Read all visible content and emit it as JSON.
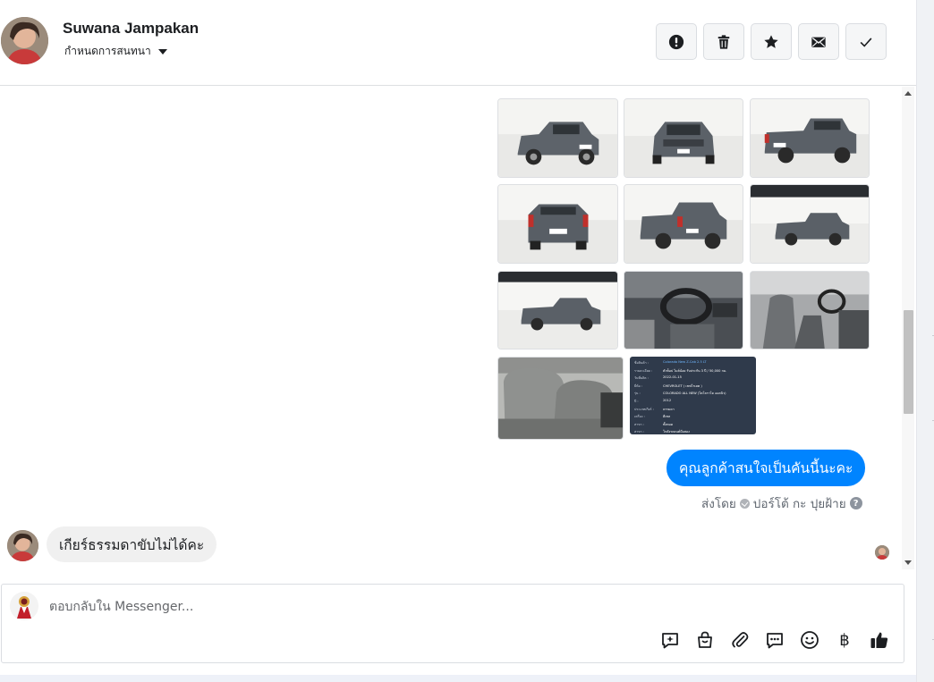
{
  "header": {
    "contact_name": "Suwana Jampakan",
    "assign_label": "กำหนดการสนทนา",
    "actions": [
      {
        "name": "mark-spam-button",
        "icon": "alert-icon"
      },
      {
        "name": "delete-button",
        "icon": "trash-icon"
      },
      {
        "name": "star-button",
        "icon": "star-icon"
      },
      {
        "name": "mark-unread-button",
        "icon": "envelope-icon"
      },
      {
        "name": "mark-done-button",
        "icon": "check-icon"
      }
    ]
  },
  "conversation": {
    "car_photo_count": 10,
    "document_photo": {
      "rows": [
        {
          "key": "ชื่อสินค้า :",
          "value": "Colorado New Z-Cab 2.5 LT"
        },
        {
          "key": "รายละเอียด :",
          "value": "ตัวท็อป ไมล์น้อย รับประกัน 3 ปี / 50,000 กม."
        },
        {
          "key": "วันที่ผลิต :",
          "value": "2022-01-15"
        },
        {
          "key": "ยี่ห้อ :",
          "value": "CHEVROLET ( เชฟโรเลต )"
        },
        {
          "key": "รุ่น :",
          "value": "COLORADO ALL NEW (โคโลราโด ออลนิว)"
        },
        {
          "key": "ปี :",
          "value": "2012"
        },
        {
          "key": "ประเภทเกียร์ :",
          "value": "ธรรมดา"
        },
        {
          "key": "เครื่อง :",
          "value": "ดีเซล"
        },
        {
          "key": "สาขา :",
          "value": "ทั้งหมด"
        },
        {
          "key": "สาขา :",
          "value": "โกดังรถยนต์มือสอง"
        }
      ]
    },
    "outgoing_message": "คุณลูกค้าสนใจเป็นคันนี้นะคะ",
    "sent_by_prefix": "ส่งโดย",
    "sent_by_name": "ปอร์โต้ กะ ปุยฝ้าย",
    "help_glyph": "?",
    "incoming_message": "เกียร์ธรรมดาขับไม่ได้คะ"
  },
  "composer": {
    "placeholder": "ตอบกลับใน Messenger...",
    "tools": [
      "sparkle-icon",
      "shopping-bag-icon",
      "paperclip-icon",
      "quick-reply-icon",
      "emoji-icon",
      "baht-icon",
      "thumbs-up-icon"
    ],
    "baht_glyph": "฿"
  },
  "colors": {
    "accent": "#0084ff",
    "incoming_bubble": "#f0f0f0",
    "divider": "#dddfe2"
  }
}
